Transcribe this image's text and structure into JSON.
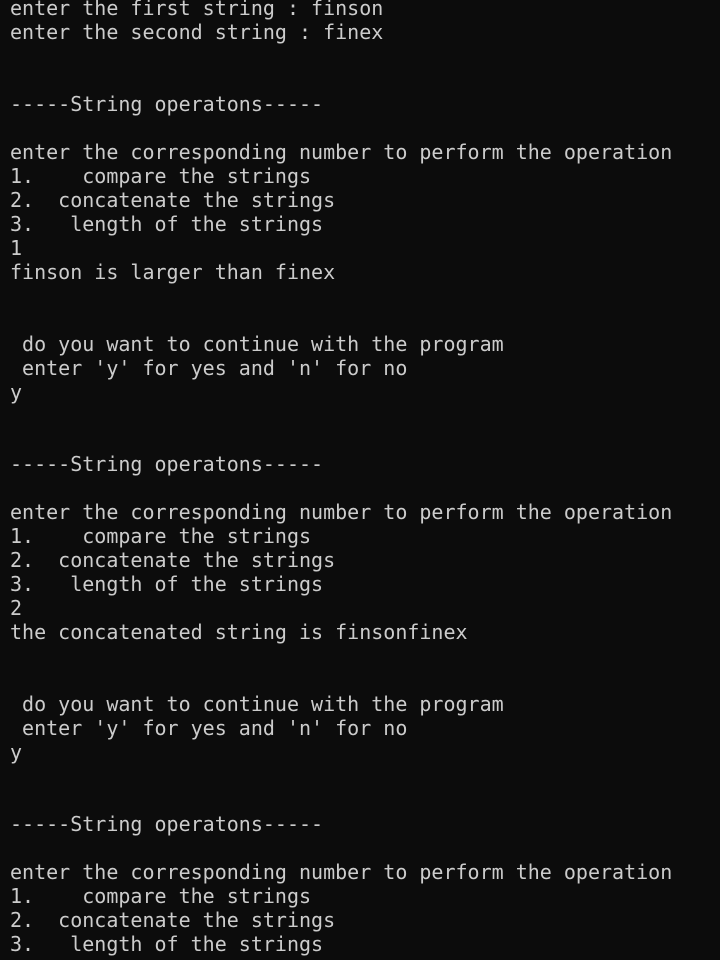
{
  "terminal": {
    "lines": [
      "enter the first string : finson",
      "enter the second string : finex",
      "",
      "",
      "-----String operatons-----",
      "",
      "enter the corresponding number to perform the operation",
      "1.    compare the strings",
      "2.  concatenate the strings",
      "3.   length of the strings",
      "1",
      "finson is larger than finex",
      "",
      "",
      " do you want to continue with the program",
      " enter 'y' for yes and 'n' for no",
      "y",
      "",
      "",
      "-----String operatons-----",
      "",
      "enter the corresponding number to perform the operation",
      "1.    compare the strings",
      "2.  concatenate the strings",
      "3.   length of the strings",
      "2",
      "the concatenated string is finsonfinex",
      "",
      "",
      " do you want to continue with the program",
      " enter 'y' for yes and 'n' for no",
      "y",
      "",
      "",
      "-----String operatons-----",
      "",
      "enter the corresponding number to perform the operation",
      "1.    compare the strings",
      "2.  concatenate the strings",
      "3.   length of the strings"
    ]
  }
}
